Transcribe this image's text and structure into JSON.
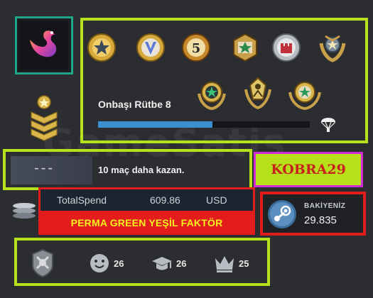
{
  "watermark": "GameSatis",
  "rank": {
    "title": "Onbaşı Rütbe 8",
    "progress": 0.54
  },
  "medals": [
    {
      "icon": "gold-star-coin-medal"
    },
    {
      "icon": "gold-v-coin-medal"
    },
    {
      "icon": "five-year-coin-medal"
    },
    {
      "icon": "green-star-pin-medal"
    },
    {
      "icon": "silver-castle-medal"
    },
    {
      "icon": "laurel-wreath-medal"
    },
    {
      "icon": "green-star-wreath-medal"
    },
    {
      "icon": "gold-figure-medal"
    },
    {
      "icon": "green-star-gold-medal"
    }
  ],
  "win": {
    "dashes": "---",
    "text": "10 maç daha kazan."
  },
  "kobra": "KOBRA29",
  "spend": {
    "label": "TotalSpend",
    "value": "609.86",
    "currency": "USD"
  },
  "perma": "PERMA GREEN YEŞİL FAKTÖR",
  "balance": {
    "label": "BAKİYENİZ",
    "value": "29.835"
  },
  "stats": {
    "friendly": "26",
    "teacher": "26",
    "leader": "25"
  },
  "colors": {
    "highlight_green": "#b6e21b",
    "highlight_red": "#e01c1c",
    "highlight_magenta": "#d02bd6",
    "progress_blue": "#3b8fd0",
    "avatar_teal": "#1fa58a"
  }
}
